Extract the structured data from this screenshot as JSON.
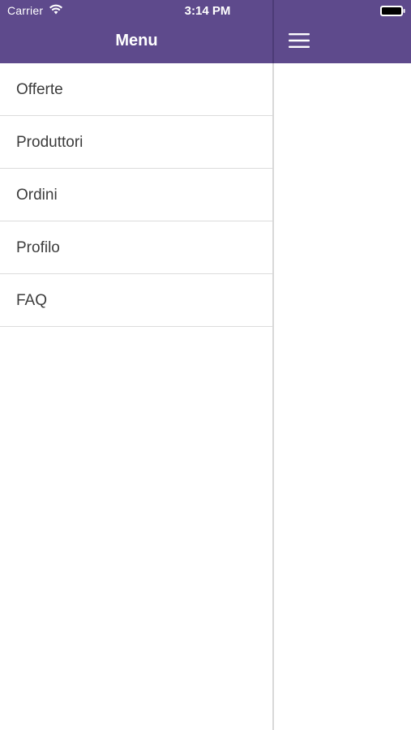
{
  "status_bar": {
    "carrier": "Carrier",
    "time": "3:14 PM",
    "wifi_icon": "wifi-icon",
    "battery_icon": "battery-icon"
  },
  "nav": {
    "title": "Menu",
    "toggle_icon": "hamburger-menu-icon"
  },
  "menu": {
    "items": [
      {
        "label": "Offerte"
      },
      {
        "label": "Produttori"
      },
      {
        "label": "Ordini"
      },
      {
        "label": "Profilo"
      },
      {
        "label": "FAQ"
      }
    ]
  },
  "colors": {
    "header_background": "#5e4a8c",
    "text_primary": "#3c3c3c",
    "separator": "#dcdcdc"
  }
}
